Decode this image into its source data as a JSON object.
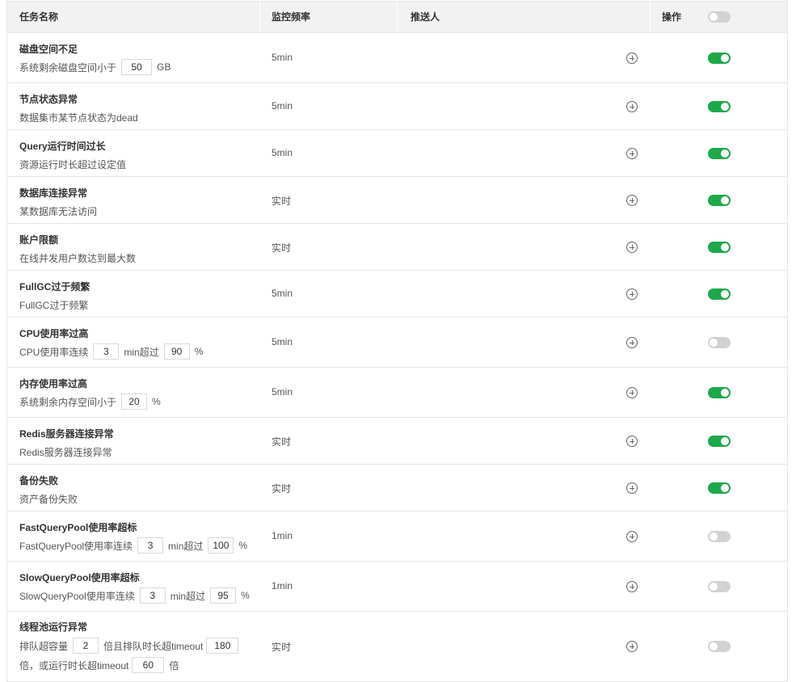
{
  "header": {
    "task_name": "任务名称",
    "frequency": "监控频率",
    "pusher": "推送人",
    "action": "操作",
    "master_toggle_on": false
  },
  "colors": {
    "toggle_on": "#1ea84a",
    "toggle_off": "#d2d2d2",
    "header_bg": "#f2f2f2"
  },
  "rows": [
    {
      "title": "磁盘空间不足",
      "desc": [
        "系统剩余磁盘空间小于",
        "GB"
      ],
      "inputs": [
        "50"
      ],
      "freq": "5min",
      "enabled": true
    },
    {
      "title": "节点状态异常",
      "desc": [
        "数据集市某节点状态为dead"
      ],
      "inputs": [],
      "freq": "5min",
      "enabled": true
    },
    {
      "title": "Query运行时间过长",
      "desc": [
        "资源运行时长超过设定值"
      ],
      "inputs": [],
      "freq": "5min",
      "enabled": true
    },
    {
      "title": "数据库连接异常",
      "desc": [
        "某数据库无法访问"
      ],
      "inputs": [],
      "freq": "实时",
      "enabled": true
    },
    {
      "title": "账户限额",
      "desc": [
        "在线并发用户数达到最大数"
      ],
      "inputs": [],
      "freq": "实时",
      "enabled": true
    },
    {
      "title": "FullGC过于频繁",
      "desc": [
        "FullGC过于频繁"
      ],
      "inputs": [],
      "freq": "5min",
      "enabled": true
    },
    {
      "title": "CPU使用率过高",
      "desc": [
        "CPU使用率连续",
        "min超过",
        "%"
      ],
      "inputs": [
        "3",
        "90"
      ],
      "freq": "5min",
      "enabled": false
    },
    {
      "title": "内存使用率过高",
      "desc": [
        "系统剩余内存空间小于",
        "%"
      ],
      "inputs": [
        "20"
      ],
      "freq": "5min",
      "enabled": true
    },
    {
      "title": "Redis服务器连接异常",
      "desc": [
        "Redis服务器连接异常"
      ],
      "inputs": [],
      "freq": "实时",
      "enabled": true
    },
    {
      "title": "备份失败",
      "desc": [
        "资产备份失败"
      ],
      "inputs": [],
      "freq": "实时",
      "enabled": true
    },
    {
      "title": "FastQueryPool使用率超标",
      "desc": [
        "FastQueryPool使用率连续",
        "min超过",
        "%"
      ],
      "inputs": [
        "3",
        "100"
      ],
      "freq": "1min",
      "enabled": false
    },
    {
      "title": "SlowQueryPool使用率超标",
      "desc": [
        "SlowQueryPool使用率连续",
        "min超过",
        "%"
      ],
      "inputs": [
        "3",
        "95"
      ],
      "freq": "1min",
      "enabled": false
    },
    {
      "title": "线程池运行异常",
      "desc": [
        "排队超容量",
        "倍且排队时长超timeout",
        "倍，或运行时长超timeout",
        "倍"
      ],
      "inputs": [
        "2",
        "180",
        "60"
      ],
      "freq": "实时",
      "enabled": false
    }
  ]
}
